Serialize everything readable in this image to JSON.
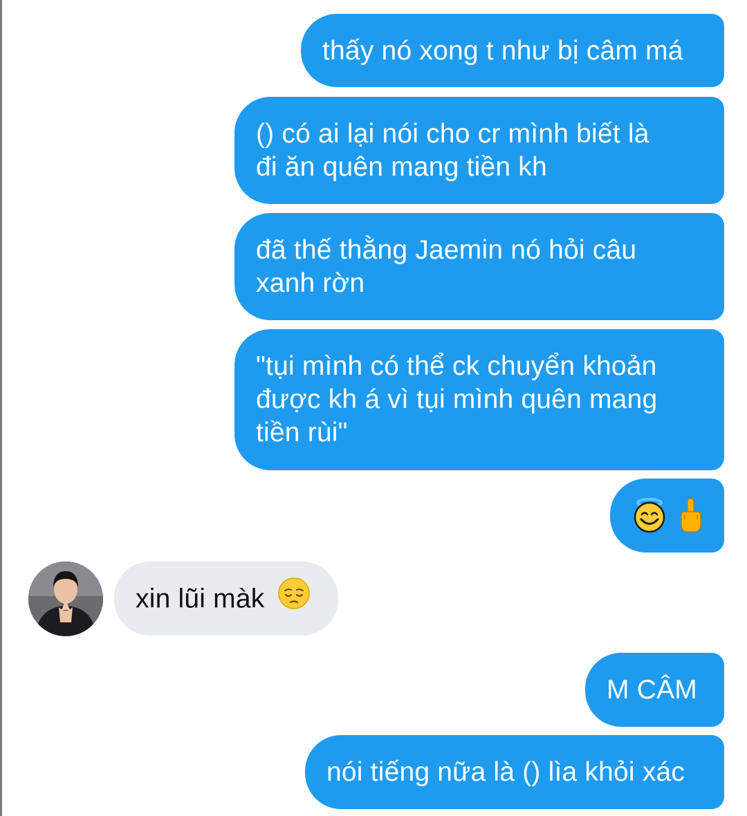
{
  "conversation": {
    "messages": [
      {
        "side": "outgoing",
        "text": "thấy nó xong t như bị câm má"
      },
      {
        "side": "outgoing",
        "lines": [
          "() có ai lại nói cho cr mình biết là",
          "đi ăn quên mang tiền kh"
        ]
      },
      {
        "side": "outgoing",
        "lines": [
          "đã thế thằng Jaemin nó hỏi câu",
          "xanh rờn"
        ]
      },
      {
        "side": "outgoing",
        "lines": [
          "\"tụi mình có thể ck chuyển khoản",
          "được kh á vì tụi mình quên mang",
          "tiền rùi\""
        ]
      },
      {
        "side": "outgoing",
        "emojis": [
          "smiling-face-with-halo",
          "middle-finger"
        ]
      },
      {
        "side": "incoming",
        "text": "xin lũi màk",
        "emoji": "pensive-face",
        "avatar": "contact-avatar"
      },
      {
        "side": "outgoing",
        "text": "M CÂM"
      },
      {
        "side": "outgoing",
        "text": "nói tiếng nữa là () lìa khỏi xác"
      }
    ]
  },
  "colors": {
    "outgoing_bubble": "#1e9bef",
    "incoming_bubble": "#e8ebef",
    "outgoing_text": "#ffffff",
    "incoming_text": "#111111"
  }
}
